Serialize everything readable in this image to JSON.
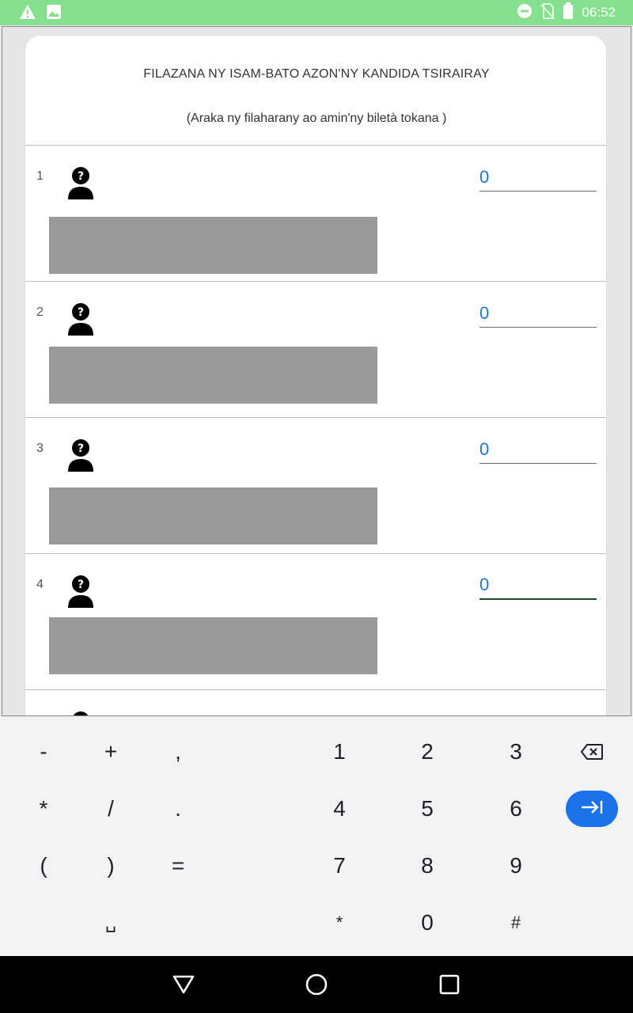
{
  "status_bar": {
    "time": "06:52",
    "icons": [
      "warning-icon",
      "image-icon",
      "do-not-disturb-icon",
      "no-sim-icon",
      "battery-icon"
    ],
    "background": "#84e08c"
  },
  "form": {
    "title": "FILAZANA NY ISAM-BATO AZON'NY KANDIDA TSIRAIRAY",
    "subtitle": "(Araka ny filaharany ao amin'ny biletà tokana )",
    "candidates": [
      {
        "number": "1",
        "votes": "0"
      },
      {
        "number": "2",
        "votes": "0"
      },
      {
        "number": "3",
        "votes": "0"
      },
      {
        "number": "4",
        "votes": "0"
      }
    ],
    "accent_color": "#1e78d6"
  },
  "keyboard": {
    "rows": [
      [
        "-",
        "+",
        ",",
        "1",
        "2",
        "3"
      ],
      [
        "*",
        "/",
        ".",
        "4",
        "5",
        "6"
      ],
      [
        "(",
        ")",
        "=",
        "7",
        "8",
        "9"
      ],
      [
        "␣",
        "*",
        "0",
        "#"
      ]
    ],
    "enter_color": "#1a73e8"
  },
  "nav_bar": {
    "buttons": [
      "back-icon",
      "home-icon",
      "recents-icon"
    ]
  }
}
